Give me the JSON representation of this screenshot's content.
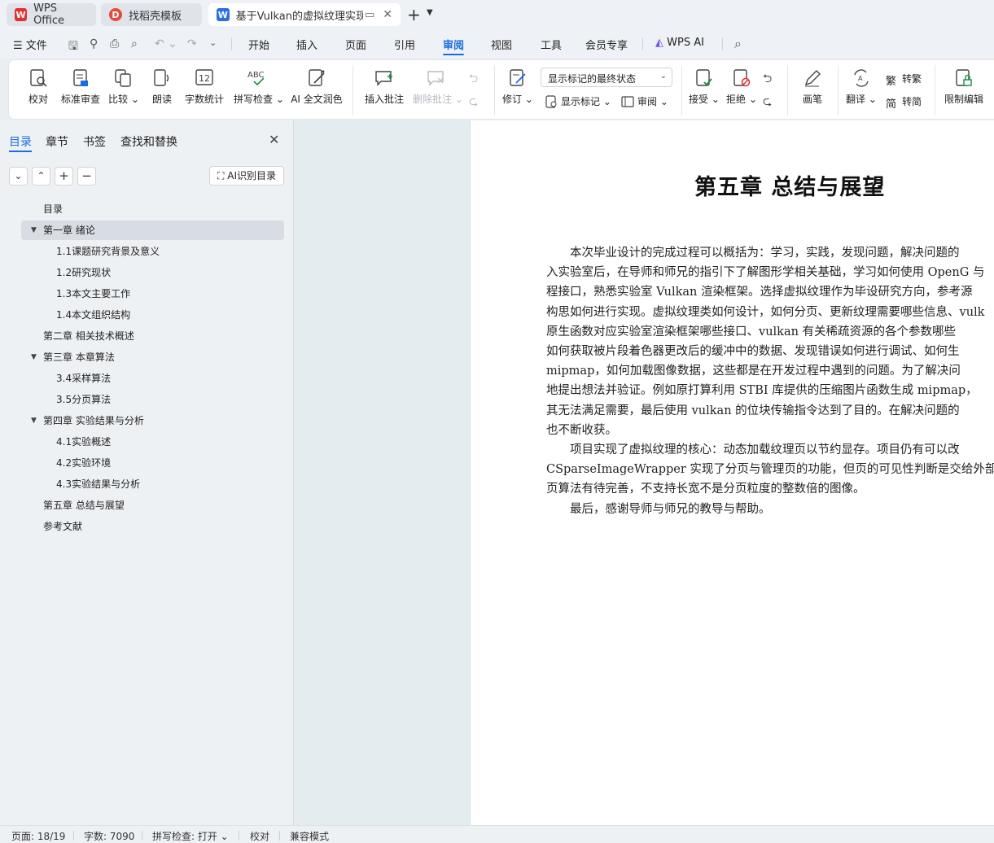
{
  "titlebar": {
    "tabs": [
      {
        "label": "WPS Office",
        "icon": "wps-logo-icon"
      },
      {
        "label": "找稻壳模板",
        "icon": "docer-logo-icon"
      },
      {
        "label": "基于Vulkan的虚拟纹理实现",
        "icon": "word-doc-icon"
      }
    ],
    "new_tab": "+",
    "tab_list": "⌄"
  },
  "menubar": {
    "file": "文件",
    "items": [
      "开始",
      "插入",
      "页面",
      "引用",
      "审阅",
      "视图",
      "工具",
      "会员专享",
      "WPS AI"
    ],
    "active": "审阅"
  },
  "ribbon": {
    "proofread": "校对",
    "standard_review": "标准审查",
    "compare": "比较",
    "read_aloud": "朗读",
    "word_count": "字数统计",
    "spell_check": "拼写检查",
    "ai_polish": "AI 全文润色",
    "insert_comment": "插入批注",
    "delete_comment": "删除批注",
    "track_changes": "修订",
    "markup_dropdown": "显示标记的最终状态",
    "show_markup": "显示标记",
    "review": "审阅",
    "accept": "接受",
    "reject": "拒绝",
    "pen": "画笔",
    "translate": "翻译",
    "to_traditional": "转繁",
    "to_simplified": "转简",
    "restrict_edit": "限制编辑"
  },
  "navpanel": {
    "tabs": [
      "目录",
      "章节",
      "书签",
      "查找和替换"
    ],
    "active_tab": "目录",
    "ai_button": "AI识别目录",
    "toc": [
      {
        "label": "目录",
        "level": 0,
        "arrow": false
      },
      {
        "label": "第一章  绪论",
        "level": 0,
        "arrow": true,
        "selected": true
      },
      {
        "label": "1.1课题研究背景及意义",
        "level": 1
      },
      {
        "label": "1.2研究现状",
        "level": 1
      },
      {
        "label": "1.3本文主要工作",
        "level": 1
      },
      {
        "label": "1.4本文组织结构",
        "level": 1
      },
      {
        "label": "第二章  相关技术概述",
        "level": 0,
        "arrow": false
      },
      {
        "label": "第三章  本章算法",
        "level": 0,
        "arrow": true
      },
      {
        "label": "3.4采样算法",
        "level": 1
      },
      {
        "label": "3.5分页算法",
        "level": 1
      },
      {
        "label": "第四章  实验结果与分析",
        "level": 0,
        "arrow": true
      },
      {
        "label": "4.1实验概述",
        "level": 1
      },
      {
        "label": "4.2实验环境",
        "level": 1
      },
      {
        "label": "4.3实验结果与分析",
        "level": 1
      },
      {
        "label": "第五章  总结与展望",
        "level": 0,
        "arrow": false
      },
      {
        "label": "参考文献",
        "level": 0,
        "arrow": false
      }
    ]
  },
  "document": {
    "chapter_title": "第五章   总结与展望",
    "lines": [
      "　　本次毕业设计的完成过程可以概括为：学习，实践，发现问题，解决问题的",
      "入实验室后，在导师和师兄的指引下了解图形学相关基础，学习如何使用 OpenG 与",
      "程接口，熟悉实验室 Vulkan 渲染框架。选择虚拟纹理作为毕设研究方向，参考源",
      "构思如何进行实现。虚拟纹理类如何设计，如何分页、更新纹理需要哪些信息、vulk",
      "原生函数对应实验室渲染框架哪些接口、vulkan 有关稀疏资源的各个参数哪些",
      "如何获取被片段着色器更改后的缓冲中的数据、发现错误如何进行调试、如何生",
      "mipmap，如何加载图像数据，这些都是在开发过程中遇到的问题。为了解决问",
      "地提出想法并验证。例如原打算利用 STBI 库提供的压缩图片函数生成 mipmap，",
      "其无法满足需要，最后使用 vulkan 的位块传输指令达到了目的。在解决问题的",
      "也不断收获。",
      "　　项目实现了虚拟纹理的核心：动态加载纹理页以节约显存。项目仍有可以改",
      "CSparseImageWrapper 实现了分页与管理页的功能，但页的可见性判断是交给外部",
      "页算法有待完善，不支持长宽不是分页粒度的整数倍的图像。",
      "　　最后，感谢导师与师兄的教导与帮助。"
    ]
  },
  "statusbar": {
    "page": "页面: 18/19",
    "words": "字数: 7090",
    "spell": "拼写检查: 打开",
    "proof": "校对",
    "compat": "兼容模式"
  },
  "colors": {
    "accent": "#1a6de0",
    "wps_red": "#e3312d",
    "word_blue": "#2a6ee8"
  }
}
